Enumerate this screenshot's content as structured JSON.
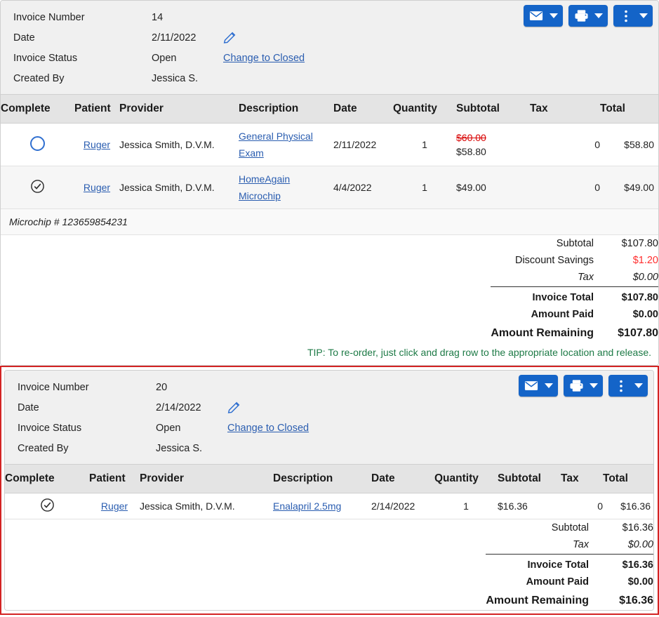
{
  "colors": {
    "accent_blue": "#1464c8",
    "link_blue": "#2a5db0",
    "discount_red": "#ff2d2d",
    "strike_red": "#d80000",
    "tip_green": "#1d7a46",
    "highlight_border": "#d32323",
    "header_bg": "#e4e4e4",
    "meta_bg": "#f0f0f0"
  },
  "table_headers": {
    "complete": "Complete",
    "patient": "Patient",
    "provider": "Provider",
    "description": "Description",
    "date": "Date",
    "quantity": "Quantity",
    "subtotal": "Subtotal",
    "tax": "Tax",
    "total": "Total"
  },
  "meta_labels": {
    "invoice_number": "Invoice Number",
    "date": "Date",
    "invoice_status": "Invoice Status",
    "created_by": "Created By"
  },
  "toolbar": {
    "email_icon": "envelope-icon",
    "print_icon": "printer-icon",
    "more_icon": "vertical-dots-icon",
    "caret_icon": "caret-down-icon"
  },
  "totals_labels": {
    "subtotal": "Subtotal",
    "discount_savings": "Discount Savings",
    "tax": "Tax",
    "invoice_total": "Invoice Total",
    "amount_paid": "Amount Paid",
    "amount_remaining": "Amount Remaining"
  },
  "invoice1": {
    "highlighted": false,
    "number": "14",
    "date": "2/11/2022",
    "status": "Open",
    "status_action": "Change to Closed",
    "created_by": "Jessica S.",
    "edit_icon": "pencil-icon",
    "rows": [
      {
        "complete": false,
        "complete_icon": "circle-empty-icon",
        "patient": "Ruger",
        "provider": "Jessica Smith, D.V.M.",
        "description": "General Physical Exam",
        "date": "2/11/2022",
        "quantity": "1",
        "subtotal_original": "$60.00",
        "subtotal": "$58.80",
        "tax": "0",
        "total": "$58.80",
        "note": null
      },
      {
        "complete": true,
        "complete_icon": "circle-check-icon",
        "patient": "Ruger",
        "provider": "Jessica Smith, D.V.M.",
        "description": "HomeAgain Microchip",
        "date": "4/4/2022",
        "quantity": "1",
        "subtotal_original": null,
        "subtotal": "$49.00",
        "tax": "0",
        "total": "$49.00",
        "note": "Microchip # 123659854231"
      }
    ],
    "totals": {
      "subtotal": "$107.80",
      "discount_savings": "$1.20",
      "tax": "$0.00",
      "invoice_total": "$107.80",
      "amount_paid": "$0.00",
      "amount_remaining": "$107.80"
    },
    "tip": "TIP: To re-order, just click and drag row to the appropriate location and release."
  },
  "invoice2": {
    "highlighted": true,
    "number": "20",
    "date": "2/14/2022",
    "status": "Open",
    "status_action": "Change to Closed",
    "created_by": "Jessica S.",
    "edit_icon": "pencil-icon",
    "rows": [
      {
        "complete": true,
        "complete_icon": "circle-check-icon",
        "patient": "Ruger",
        "provider": "Jessica Smith, D.V.M.",
        "description": "Enalapril 2.5mg",
        "date": "2/14/2022",
        "quantity": "1",
        "subtotal_original": null,
        "subtotal": "$16.36",
        "tax": "0",
        "total": "$16.36",
        "note": null
      }
    ],
    "totals": {
      "subtotal": "$16.36",
      "discount_savings": null,
      "tax": "$0.00",
      "invoice_total": "$16.36",
      "amount_paid": "$0.00",
      "amount_remaining": "$16.36"
    },
    "tip": null
  }
}
